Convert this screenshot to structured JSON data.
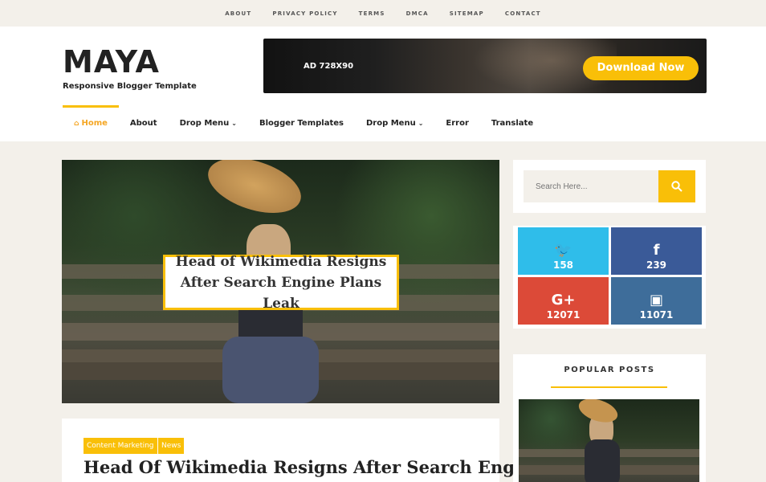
{
  "topnav": [
    "ABOUT",
    "PRIVACY POLICY",
    "TERMS",
    "DMCA",
    "SITEMAP",
    "CONTACT"
  ],
  "brand": {
    "logo": "MAYA",
    "tagline": "Responsive Blogger Template"
  },
  "ad": {
    "label": "AD 728X90",
    "button": "Download Now"
  },
  "menu": [
    {
      "label": "Home",
      "icon": "home-icon",
      "active": true
    },
    {
      "label": "About"
    },
    {
      "label": "Drop Menu",
      "dropdown": true
    },
    {
      "label": "Blogger Templates"
    },
    {
      "label": "Drop Menu",
      "dropdown": true
    },
    {
      "label": "Error"
    },
    {
      "label": "Translate"
    }
  ],
  "hero": {
    "title_line1": "Head of Wikimedia Resigns",
    "title_line2": "After Search Engine Plans Leak"
  },
  "post": {
    "tags": [
      "Content Marketing",
      "News"
    ],
    "title": "Head Of Wikimedia Resigns After Search Engine"
  },
  "search": {
    "placeholder": "Search Here..."
  },
  "social": [
    {
      "network": "twitter",
      "icon": "twitter-icon",
      "count": "158",
      "color": "#2fbdea"
    },
    {
      "network": "facebook",
      "icon": "facebook-icon",
      "count": "239",
      "color": "#3a5a98"
    },
    {
      "network": "google-plus",
      "icon": "google-plus-icon",
      "count": "12071",
      "color": "#dc4a38"
    },
    {
      "network": "instagram",
      "icon": "instagram-icon",
      "count": "11071",
      "color": "#3e6d9a"
    }
  ],
  "popular": {
    "title": "POPULAR POSTS"
  },
  "colors": {
    "accent": "#f9bf08",
    "background": "#f3f0ea"
  }
}
